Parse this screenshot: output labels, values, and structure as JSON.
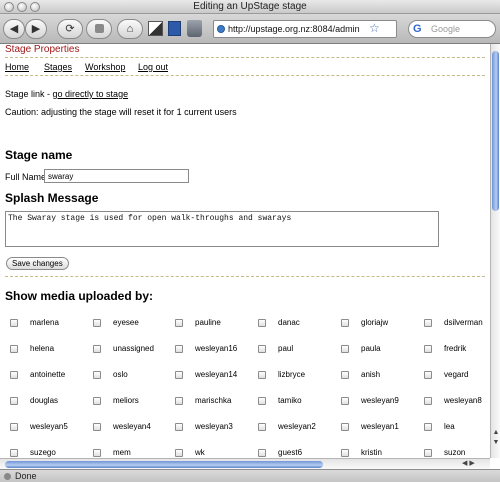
{
  "window": {
    "title": "Editing an UpStage stage"
  },
  "toolbar": {
    "back_glyph": "◀",
    "forward_glyph": "▶",
    "reload_glyph": "⟳",
    "home_glyph": "⌂",
    "url": "http://upstage.org.nz:8084/admin",
    "search_placeholder": "Google",
    "google_glyph": "G"
  },
  "statusbar": {
    "text": "Done"
  },
  "page": {
    "title": "Stage Properties",
    "nav": [
      "Home",
      "Stages",
      "Workshop",
      "Log out"
    ],
    "stage_link_label": "Stage link - ",
    "stage_link_text": "go directly to stage",
    "caution": "Caution: adjusting the stage will reset it for 1 current users",
    "stage_name_heading": "Stage name",
    "full_name_label": "Full Name:",
    "full_name_value": "swaray",
    "splash_heading": "Splash Message",
    "splash_value": "The Swaray stage is used for open walk-throughs and swarays",
    "save_label": "Save changes",
    "media_heading": "Show media uploaded by:",
    "users": [
      [
        "marlena",
        "eyesee",
        "pauline",
        "danac",
        "gloriajw",
        "dsilverman"
      ],
      [
        "helena",
        "unassigned",
        "wesleyan16",
        "paul",
        "paula",
        "fredrik"
      ],
      [
        "antoinette",
        "oslo",
        "wesleyan14",
        "lizbryce",
        "anish",
        "vegard"
      ],
      [
        "douglas",
        "meliors",
        "marischka",
        "tamiko",
        "wesleyan9",
        "wesleyan8"
      ],
      [
        "wesleyan5",
        "wesleyan4",
        "wesleyan3",
        "wesleyan2",
        "wesleyan1",
        "lea"
      ],
      [
        "suzego",
        "mem",
        "wk",
        "guest6",
        "kristin",
        "suzon"
      ]
    ]
  }
}
